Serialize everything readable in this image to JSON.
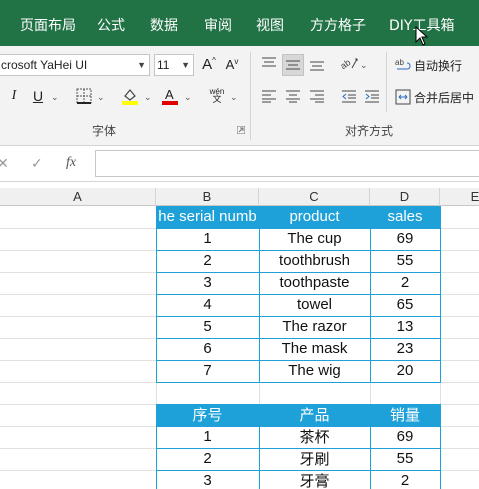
{
  "ribbon_tabs": [
    "页面布局",
    "公式",
    "数据",
    "审阅",
    "视图",
    "方方格子",
    "DIY工具箱"
  ],
  "font": {
    "name": "crosoft YaHei UI",
    "size": "11",
    "increase_label": "A",
    "decrease_label": "A",
    "italic_label": "I",
    "underline_label": "U",
    "phonetic_top": "wén",
    "phonetic_bottom": "文",
    "group_label": "字体"
  },
  "alignment": {
    "wrap_text_label": "自动换行",
    "merge_center_label": "合并后居中",
    "group_label": "对齐方式"
  },
  "formula_bar": {
    "fx_label": "fx",
    "value": ""
  },
  "columns": [
    "A",
    "B",
    "C",
    "D",
    "E"
  ],
  "table_en": {
    "headers": [
      "he serial numb",
      "product",
      "sales"
    ],
    "rows": [
      [
        "1",
        "The cup",
        "69"
      ],
      [
        "2",
        "toothbrush",
        "55"
      ],
      [
        "3",
        "toothpaste",
        "2"
      ],
      [
        "4",
        "towel",
        "65"
      ],
      [
        "5",
        "The razor",
        "13"
      ],
      [
        "6",
        "The mask",
        "23"
      ],
      [
        "7",
        "The wig",
        "20"
      ]
    ]
  },
  "table_cn": {
    "headers": [
      "序号",
      "产品",
      "销量"
    ],
    "rows": [
      [
        "1",
        "茶杯",
        "69"
      ],
      [
        "2",
        "牙刷",
        "55"
      ],
      [
        "3",
        "牙膏",
        "2"
      ]
    ]
  },
  "colors": {
    "ribbon_tab_bg": "#217346",
    "header_fill": "#1ea1d8",
    "font_color_underline": "#e00000",
    "highlight_color": "#ffff00"
  }
}
